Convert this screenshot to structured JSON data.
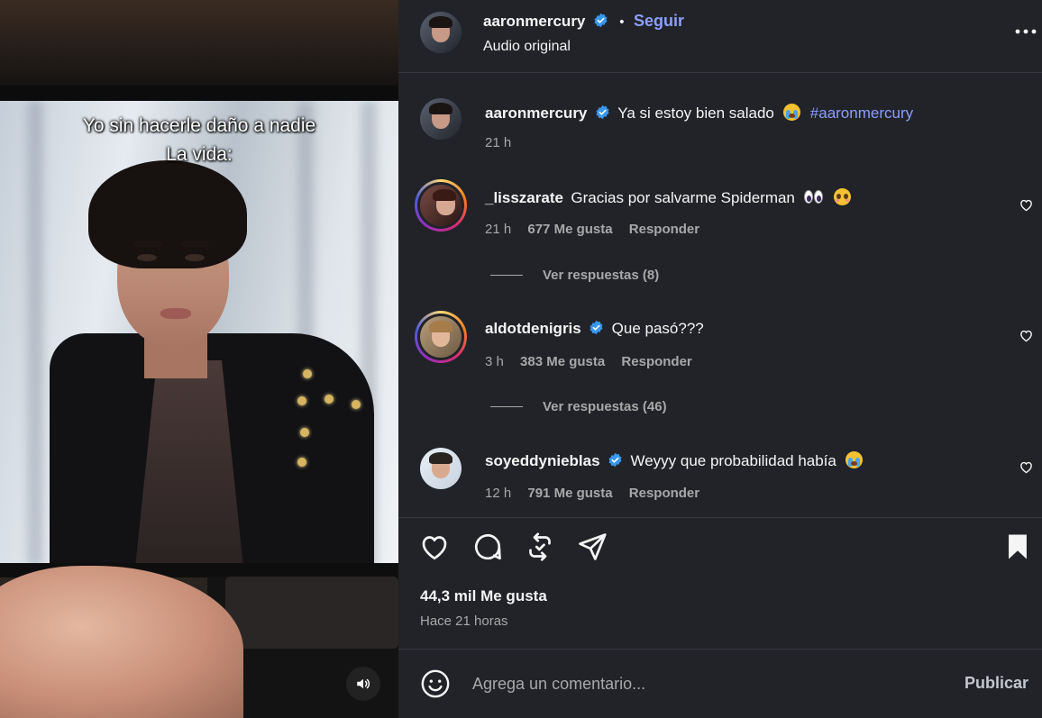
{
  "video": {
    "caption_line1": "Yo sin hacerle daño a nadie",
    "caption_line2": "La vida:",
    "mute_icon": "speaker-icon"
  },
  "header": {
    "username": "aaronmercury",
    "dot": "•",
    "follow_label": "Seguir",
    "subtitle": "Audio original",
    "more_icon": "more-options-icon"
  },
  "caption": {
    "username": "aaronmercury",
    "text": "Ya si estoy bien salado",
    "emoji": "crying-face-emoji",
    "hashtag": "#aaronmercury",
    "time": "21 h"
  },
  "comments": [
    {
      "username": "_lisszarate",
      "text": "Gracias por salvarme Spiderman",
      "emojis": [
        "eyes-emoji",
        "pleading-face-emoji"
      ],
      "time": "21 h",
      "likes": "677 Me gusta",
      "reply_label": "Responder",
      "view_replies": "Ver respuestas (8)",
      "verified": false
    },
    {
      "username": "aldotdenigris",
      "text": "Que pasó???",
      "emojis": [],
      "time": "3 h",
      "likes": "383 Me gusta",
      "reply_label": "Responder",
      "view_replies": "Ver respuestas (46)",
      "verified": true
    },
    {
      "username": "soyeddynieblas",
      "text": "Weyyy que probabilidad había",
      "emojis": [
        "crying-face-emoji"
      ],
      "time": "12 h",
      "likes": "791 Me gusta",
      "reply_label": "Responder",
      "verified": true
    }
  ],
  "actions": {
    "like_icon": "heart-icon",
    "comment_icon": "comment-icon",
    "repost_icon": "repost-icon",
    "share_icon": "send-icon",
    "save_icon": "bookmark-icon"
  },
  "stats": {
    "likes": "44,3 mil Me gusta",
    "posted_ago": "Hace 21 horas"
  },
  "comment_box": {
    "placeholder": "Agrega un comentario...",
    "publish_label": "Publicar"
  },
  "colors": {
    "panel_bg": "#212328",
    "link": "#8c9eff",
    "verified": "#3897f0",
    "muted_text": "#a8a8a8"
  }
}
